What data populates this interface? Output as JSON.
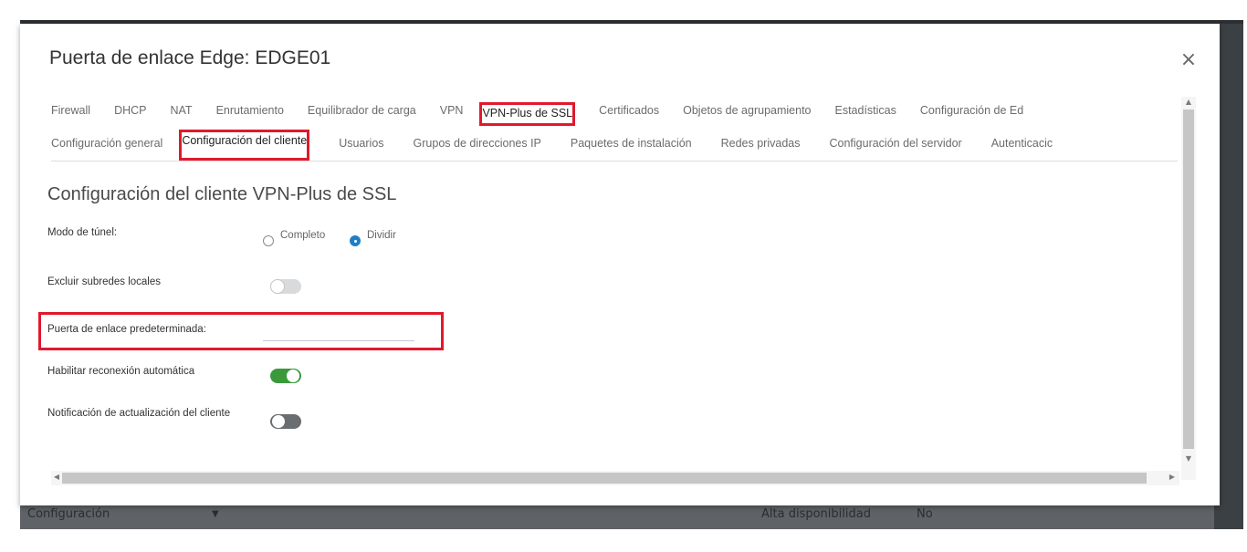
{
  "background": {
    "footer_left": "Configuración",
    "footer_mid": "Alta disponibilidad",
    "footer_value": "No"
  },
  "modal": {
    "title": "Puerta de enlace Edge: EDGE01",
    "close_glyph": "×",
    "tabs": [
      {
        "label": "Firewall"
      },
      {
        "label": "DHCP"
      },
      {
        "label": "NAT"
      },
      {
        "label": "Enrutamiento"
      },
      {
        "label": "Equilibrador de carga"
      },
      {
        "label": "VPN"
      },
      {
        "label": "VPN-Plus de SSL",
        "active": true
      },
      {
        "label": "Certificados"
      },
      {
        "label": "Objetos de agrupamiento"
      },
      {
        "label": "Estadísticas"
      },
      {
        "label": "Configuración de Ed"
      }
    ],
    "subtabs": [
      {
        "label": "Configuración general"
      },
      {
        "label": "Configuración del cliente",
        "active": true
      },
      {
        "label": "Usuarios"
      },
      {
        "label": "Grupos de direcciones IP"
      },
      {
        "label": "Paquetes de instalación"
      },
      {
        "label": "Redes privadas"
      },
      {
        "label": "Configuración del servidor"
      },
      {
        "label": "Autenticacic"
      }
    ],
    "section_title": "Configuración del cliente VPN-Plus de SSL",
    "fields": {
      "tunnel_mode_label": "Modo de túnel:",
      "tunnel_options": [
        "Completo",
        "Dividir"
      ],
      "tunnel_selected": "Dividir",
      "exclude_subnets_label": "Excluir subredes locales",
      "exclude_subnets_on": false,
      "default_gateway_label": "Puerta de enlace predeterminada:",
      "default_gateway_value": "",
      "auto_reconnect_label": "Habilitar reconexión automática",
      "auto_reconnect_on": true,
      "client_update_label": "Notificación de actualización del cliente",
      "client_update_on": false
    }
  },
  "colors": {
    "highlight": "#e0192d",
    "toggle_on": "#3a9a3b",
    "radio_selected": "#1f7fc6"
  }
}
